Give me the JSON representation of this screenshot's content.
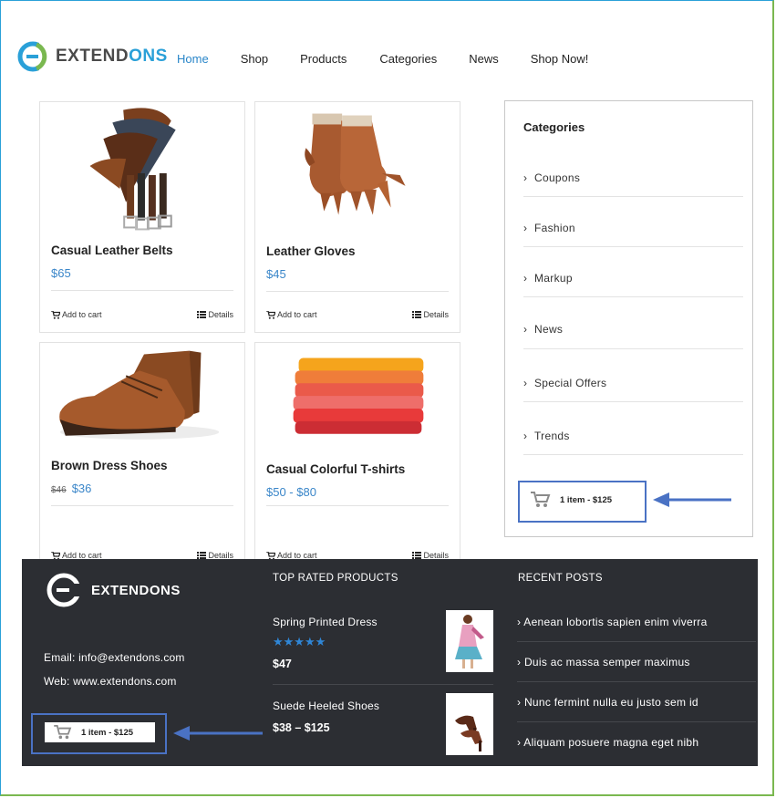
{
  "header": {
    "logo": {
      "part1": "EXTEND",
      "part2": "ONS"
    },
    "nav": [
      "Home",
      "Shop",
      "Products",
      "Categories",
      "News",
      "Shop Now!"
    ]
  },
  "products": [
    {
      "name": "Casual Leather Belts",
      "price": "$65",
      "old_price": "",
      "add_to_cart": "Add to cart",
      "details": "Details"
    },
    {
      "name": "Leather Gloves",
      "price": "$45",
      "old_price": "",
      "add_to_cart": "Add to cart",
      "details": "Details"
    },
    {
      "name": "Brown Dress Shoes",
      "price": "$36",
      "old_price": "$46",
      "add_to_cart": "Add to cart",
      "details": "Details"
    },
    {
      "name": "Casual Colorful T-shirts",
      "price": "$50 - $80",
      "old_price": "",
      "add_to_cart": "Add to cart",
      "details": "Details"
    }
  ],
  "sidebar": {
    "title": "Categories",
    "categories": [
      "Coupons",
      "Fashion",
      "Markup",
      "News",
      "Special Offers",
      "Trends"
    ],
    "cart_summary": "1 item - $125"
  },
  "footer": {
    "logo_text": "EXTENDONS",
    "email": "Email: info@extendons.com",
    "web": "Web: www.extendons.com",
    "cart_summary": "1 item - $125",
    "top_rated_title": "TOP RATED PRODUCTS",
    "top_rated": [
      {
        "name": "Spring Printed Dress",
        "price": "$47",
        "rating": 5
      },
      {
        "name": "Suede Heeled Shoes",
        "price": "$38 – $125"
      }
    ],
    "recent_posts_title": "RECENT POSTS",
    "recent_posts": [
      "Aenean lobortis sapien enim viverra",
      "Duis ac massa semper maximus",
      "Nunc fermint nulla eu justo sem id",
      "Aliquam posuere magna eget nibh"
    ]
  },
  "colors": {
    "accent": "#2a86c9",
    "footer_bg": "#2c2e33",
    "highlight": "#4a72c4"
  }
}
